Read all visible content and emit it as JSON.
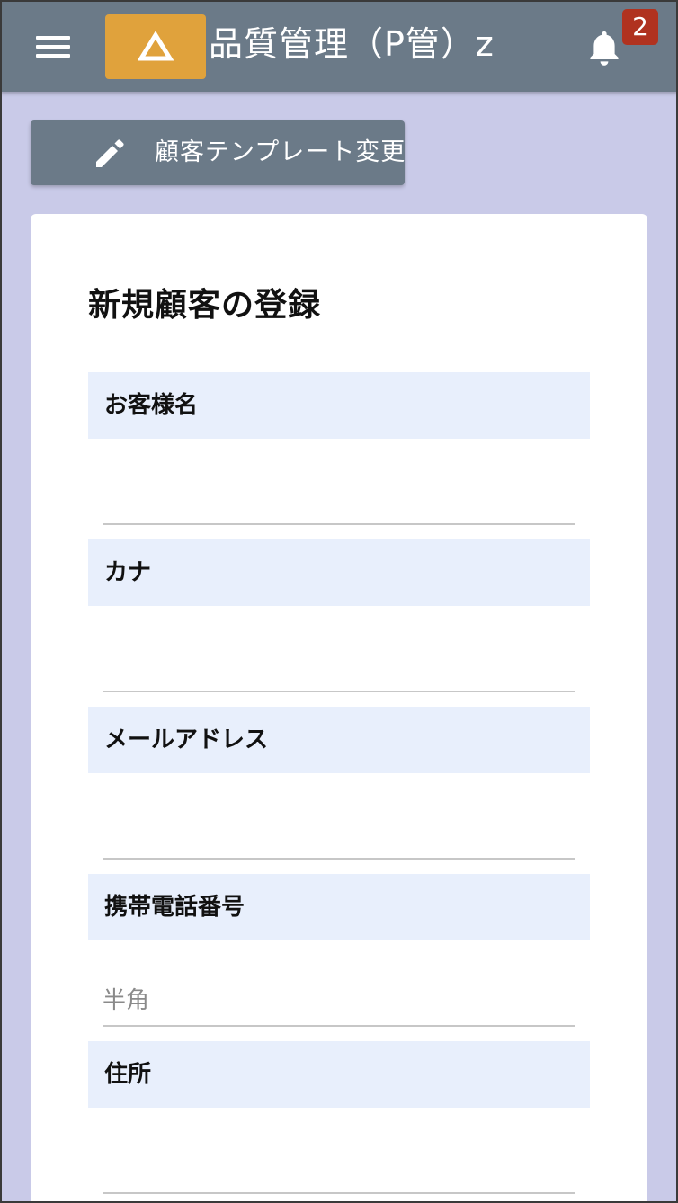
{
  "header": {
    "title": "品質管理（P管）z",
    "notification_count": "2",
    "menu_icon": "hamburger-menu-icon",
    "logo_icon": "triangle-logo-icon",
    "bell_icon": "bell-icon"
  },
  "template_button": {
    "label": "顧客テンプレート変更",
    "icon": "pencil-icon"
  },
  "form": {
    "title": "新規顧客の登録",
    "fields": [
      {
        "label": "お客様名",
        "value": "",
        "placeholder": ""
      },
      {
        "label": "カナ",
        "value": "",
        "placeholder": ""
      },
      {
        "label": "メールアドレス",
        "value": "",
        "placeholder": ""
      },
      {
        "label": "携帯電話番号",
        "value": "",
        "placeholder": "半角"
      },
      {
        "label": "住所",
        "value": "",
        "placeholder": ""
      }
    ]
  },
  "colors": {
    "appbar": "#6b7a88",
    "background": "#c9cae8",
    "logo": "#e0a23c",
    "badge": "#b0321f",
    "label_bg": "#e8effc"
  }
}
